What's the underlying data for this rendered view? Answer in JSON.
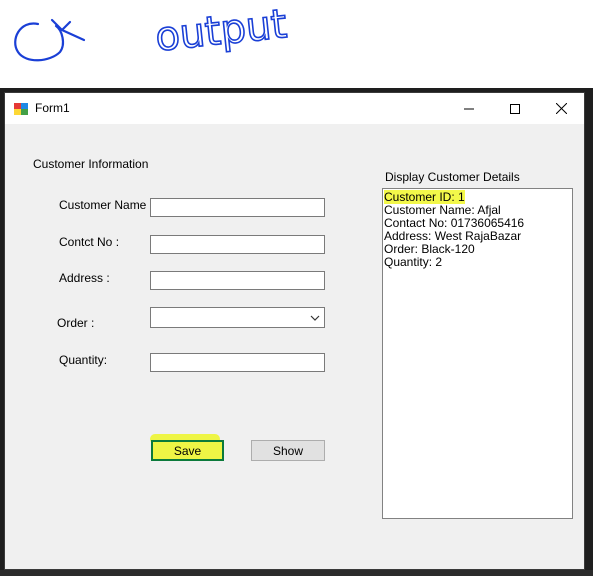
{
  "annotation": {
    "text": "output"
  },
  "window": {
    "title": "Form1"
  },
  "form": {
    "group_title": "Customer Information",
    "customer_name_label": "Customer Name :",
    "contact_label": "Contct No :",
    "address_label": "Address :",
    "order_label": "Order :",
    "quantity_label": "Quantity:",
    "customer_name_value": "",
    "contact_value": "",
    "address_value": "",
    "order_value": "",
    "quantity_value": ""
  },
  "buttons": {
    "save": "Save",
    "show": "Show"
  },
  "details": {
    "title": "Display Customer Details",
    "lines": [
      "Customer ID: 1",
      "Customer Name: Afjal",
      "Contact No: 01736065416",
      "Address: West RajaBazar",
      "Order: Black-120",
      "Quantity: 2"
    ]
  },
  "colors": {
    "highlight": "#eef545",
    "focus_border": "#0b7a3b"
  }
}
